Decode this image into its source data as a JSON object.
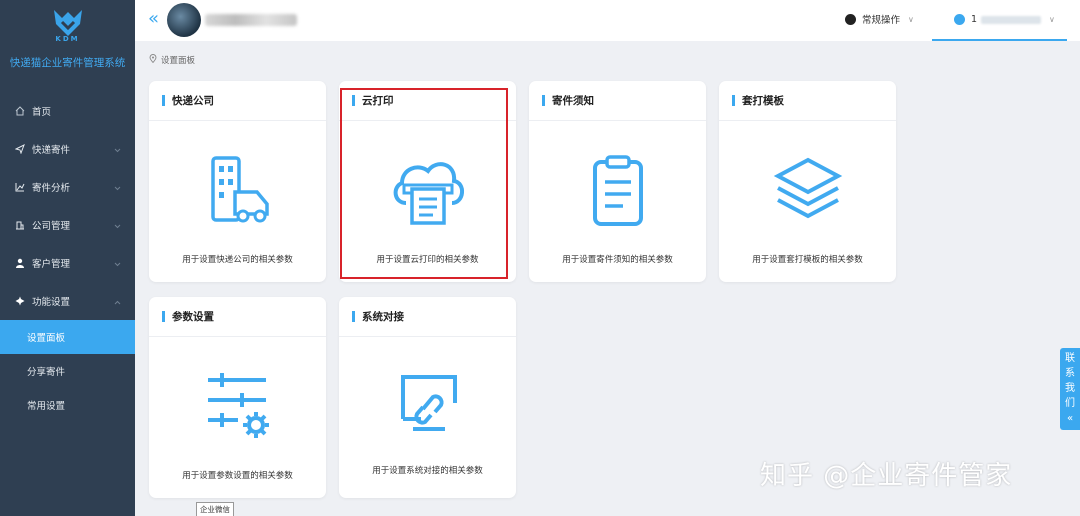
{
  "sidebar": {
    "logo_text": "KDM",
    "system_title": "快递猫企业寄件管理系统",
    "menu": [
      {
        "label": "首页",
        "icon": "home-icon",
        "has_chevron": false
      },
      {
        "label": "快递寄件",
        "icon": "send-icon",
        "has_chevron": true
      },
      {
        "label": "寄件分析",
        "icon": "chart-icon",
        "has_chevron": true
      },
      {
        "label": "公司管理",
        "icon": "building-icon",
        "has_chevron": true
      },
      {
        "label": "客户管理",
        "icon": "user-icon",
        "has_chevron": true
      },
      {
        "label": "功能设置",
        "icon": "gear-icon",
        "has_chevron": true
      }
    ],
    "submenu": [
      {
        "label": "设置面板",
        "active": true
      },
      {
        "label": "分享寄件",
        "active": false
      },
      {
        "label": "常用设置",
        "active": false
      }
    ]
  },
  "header": {
    "operations_label": "常规操作",
    "user_prefix": "1"
  },
  "breadcrumb": {
    "label": "设置面板"
  },
  "cards": [
    {
      "title": "快递公司",
      "description": "用于设置快递公司的相关参数",
      "icon": "delivery-truck-icon"
    },
    {
      "title": "云打印",
      "description": "用于设置云打印的相关参数",
      "icon": "cloud-printer-icon"
    },
    {
      "title": "寄件须知",
      "description": "用于设置寄件须知的相关参数",
      "icon": "clipboard-icon"
    },
    {
      "title": "套打模板",
      "description": "用于设置套打模板的相关参数",
      "icon": "layers-icon"
    },
    {
      "title": "参数设置",
      "description": "用于设置参数设置的相关参数",
      "icon": "sliders-icon"
    },
    {
      "title": "系统对接",
      "description": "用于设置系统对接的相关参数",
      "icon": "link-monitor-icon"
    }
  ],
  "contact_tab": {
    "label": "联系我们",
    "chars": [
      "联",
      "系",
      "我",
      "们"
    ]
  },
  "watermark": "知乎 @企业寄件管家",
  "tooltip": "企业微信",
  "colors": {
    "accent": "#3ba8ef",
    "sidebar_bg": "#2f3f52",
    "highlight": "#d8232a"
  }
}
